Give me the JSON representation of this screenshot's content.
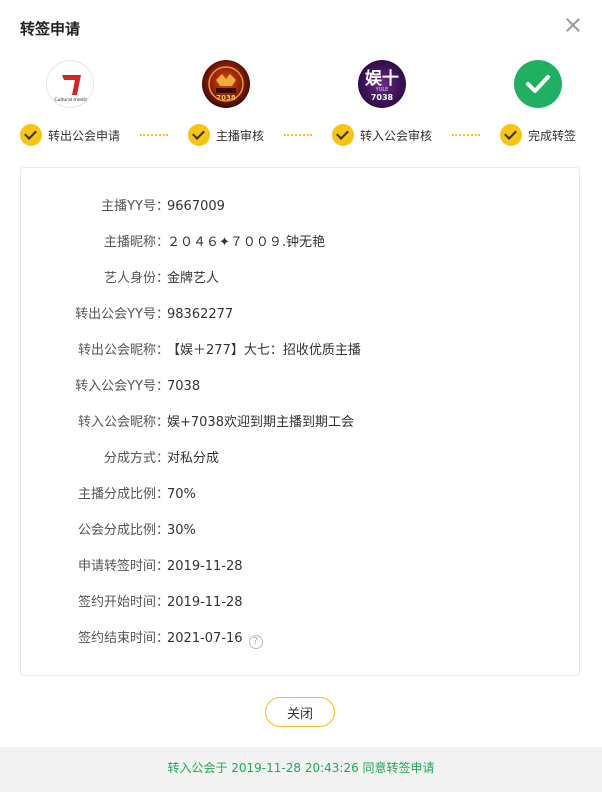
{
  "dialog": {
    "title": "转签申请"
  },
  "avatars": [
    {
      "name": "transfer-out-guild-logo",
      "text": "Cultural media",
      "icon": "guild-logo-cultural-media"
    },
    {
      "name": "anchor-avatar",
      "text": "7038",
      "icon": "anchor-avatar"
    },
    {
      "name": "transfer-in-guild-logo",
      "text": "娱十 YULE 7038",
      "icon": "guild-logo-yule-7038"
    },
    {
      "name": "complete-icon",
      "icon": "check-circle-icon"
    }
  ],
  "steps": [
    {
      "label": "转出公会申请"
    },
    {
      "label": "主播审核"
    },
    {
      "label": "转入公会审核"
    },
    {
      "label": "完成转签"
    }
  ],
  "fields": [
    {
      "label": "主播YY号：",
      "value": "9667009"
    },
    {
      "label": "主播昵称：",
      "value": "２０４６✦７００９.钟无艳"
    },
    {
      "label": "艺人身份：",
      "value": "金牌艺人"
    },
    {
      "label": "转出公会YY号：",
      "value": "98362277"
    },
    {
      "label": "转出公会昵称：",
      "value": "【娱＋277】大七：招收优质主播"
    },
    {
      "label": "转入公会YY号：",
      "value": "7038"
    },
    {
      "label": "转入公会昵称：",
      "value": "娱+7038欢迎到期主播到期工会"
    },
    {
      "label": "分成方式：",
      "value": "对私分成"
    },
    {
      "label": "主播分成比例：",
      "value": "70%"
    },
    {
      "label": "公会分成比例：",
      "value": "30%"
    },
    {
      "label": "申请转签时间：",
      "value": "2019-11-28"
    },
    {
      "label": "签约开始时间：",
      "value": "2019-11-28"
    },
    {
      "label": "签约结束时间：",
      "value": "2021-07-16"
    }
  ],
  "help_icon": "?",
  "buttons": {
    "close_label": "关闭"
  },
  "footer": {
    "status": "转入公会于 2019-11-28 20:43:26 同意转签申请"
  },
  "colors": {
    "accent_yellow": "#f7c514",
    "success_green": "#1fb061",
    "footer_text": "#1fa85a"
  }
}
